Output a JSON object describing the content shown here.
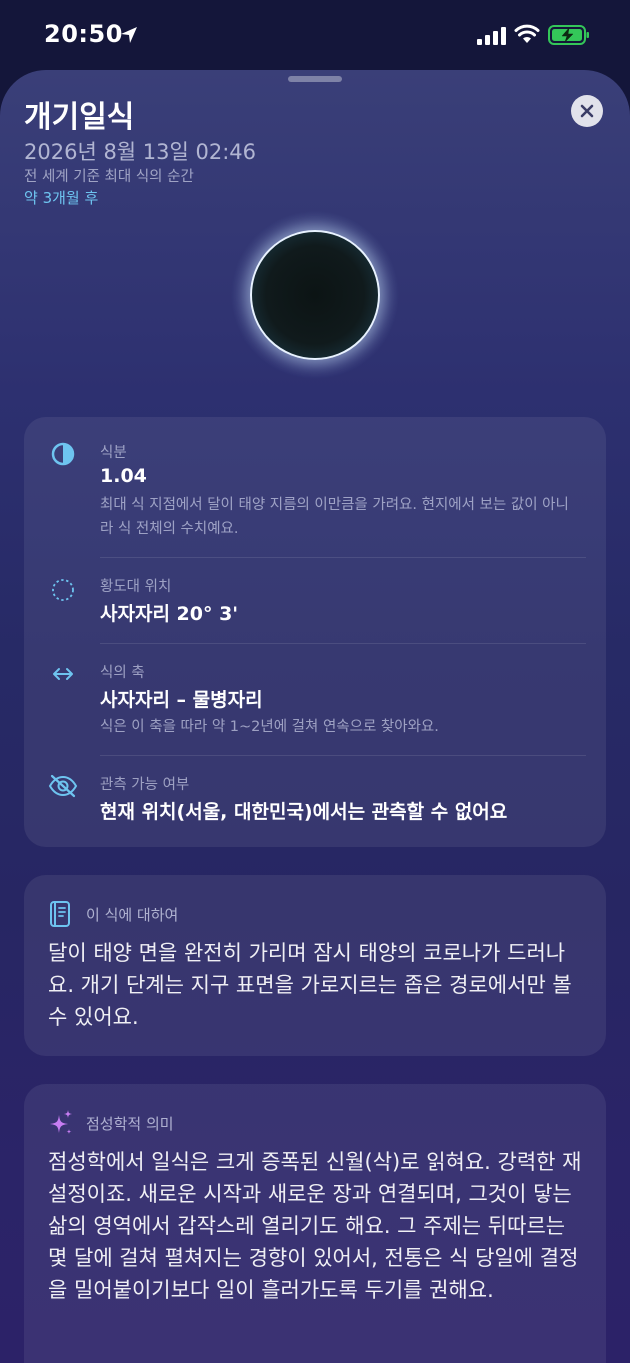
{
  "status_bar": {
    "time": "20:50"
  },
  "eclipse": {
    "title": "개기일식",
    "datetime": "2026년 8월 13일 02:46",
    "subtitle": "전 세계 기준 최대 식의 순간",
    "relative": "약 3개월 후"
  },
  "details": {
    "magnitude": {
      "label": "식분",
      "value": "1.04",
      "description": "최대 식 지점에서 달이 태양 지름의 이만큼을 가려요. 현지에서 보는 값이 아니라 식 전체의 수치예요."
    },
    "ecliptic": {
      "label": "황도대 위치",
      "value": "사자자리 20° 3'"
    },
    "axis": {
      "label": "식의 축",
      "value": "사자자리 – 물병자리",
      "description": "식은 이 축을 따라 약 1~2년에 걸쳐 연속으로 찾아와요."
    },
    "visibility": {
      "label": "관측 가능 여부",
      "value": "현재 위치(서울, 대한민국)에서는 관측할 수 없어요"
    }
  },
  "about": {
    "label": "이 식에 대하여",
    "body": "달이 태양 면을 완전히 가리며 잠시 태양의 코로나가 드러나요. 개기 단계는 지구 표면을 가로지르는 좁은 경로에서만 볼 수 있어요."
  },
  "astrology": {
    "label": "점성학적 의미",
    "body": "점성학에서 일식은 크게 증폭된 신월(삭)로 읽혀요. 강력한 재설정이죠. 새로운 시작과 새로운 장과 연결되며, 그것이 닿는 삶의 영역에서 갑작스레 열리기도 해요. 그 주제는 뒤따르는 몇 달에 걸쳐 펼쳐지는 경향이 있어서, 전통은 식 당일에 결정을 밀어붙이기보다 일이 흘러가도록 두기를 권해요."
  },
  "colors": {
    "accent_cyan": "#6ec4f0",
    "astrology_purple": "#c77df2",
    "battery_green": "#34c759"
  },
  "icons": {
    "magnitude": "half-circle-icon",
    "ecliptic": "dashed-circle-icon",
    "axis": "left-right-arrow-icon",
    "visibility": "eye-slash-icon",
    "about": "book-icon",
    "astrology": "sparkles-icon",
    "close": "close-icon"
  }
}
